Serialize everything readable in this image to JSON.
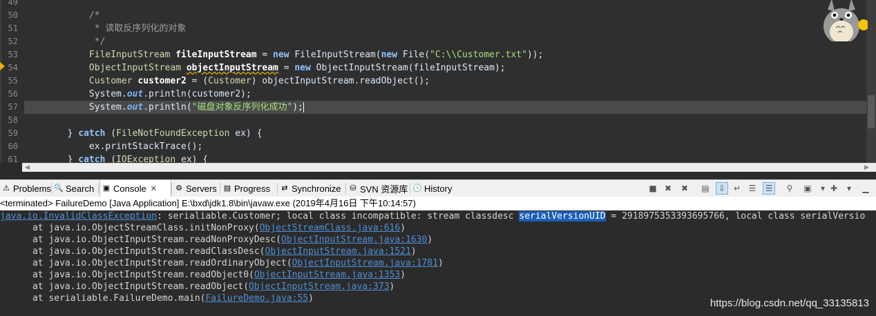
{
  "editor": {
    "line_numbers": [
      "49",
      "50",
      "51",
      "52",
      "53",
      "54",
      "55",
      "56",
      "57",
      "58",
      "59",
      "60",
      "61"
    ],
    "current_line": "57",
    "lines": [
      [
        {
          "t": "",
          "c": "pl"
        }
      ],
      [
        {
          "t": "            /*",
          "c": "cm"
        }
      ],
      [
        {
          "t": "             * 读取反序列化的对象",
          "c": "cm"
        }
      ],
      [
        {
          "t": "             */",
          "c": "cm"
        }
      ],
      [
        {
          "t": "            ",
          "c": "pl"
        },
        {
          "t": "FileInputStream",
          "c": "ty"
        },
        {
          "t": " ",
          "c": "pl"
        },
        {
          "t": "fileInputStream",
          "c": "var"
        },
        {
          "t": " = ",
          "c": "pl"
        },
        {
          "t": "new",
          "c": "kw"
        },
        {
          "t": " FileInputStream(",
          "c": "pl"
        },
        {
          "t": "new",
          "c": "kw"
        },
        {
          "t": " File(",
          "c": "pl"
        },
        {
          "t": "\"C:\\\\Customer.txt\"",
          "c": "st"
        },
        {
          "t": "));",
          "c": "pl"
        }
      ],
      [
        {
          "t": "            ",
          "c": "pl"
        },
        {
          "t": "ObjectInputStream",
          "c": "ty"
        },
        {
          "t": " ",
          "c": "pl"
        },
        {
          "t": "objectInputStream",
          "c": "var uline"
        },
        {
          "t": " = ",
          "c": "pl"
        },
        {
          "t": "new",
          "c": "kw"
        },
        {
          "t": " ObjectInputStream(fileInputStream);",
          "c": "pl"
        }
      ],
      [
        {
          "t": "            ",
          "c": "pl"
        },
        {
          "t": "Customer",
          "c": "ty"
        },
        {
          "t": " ",
          "c": "pl"
        },
        {
          "t": "customer2",
          "c": "var"
        },
        {
          "t": " = (",
          "c": "pl"
        },
        {
          "t": "Customer",
          "c": "ty"
        },
        {
          "t": ") objectInputStream.readObject();",
          "c": "pl"
        }
      ],
      [
        {
          "t": "            System.",
          "c": "pl"
        },
        {
          "t": "out",
          "c": "it"
        },
        {
          "t": ".println(customer2);",
          "c": "pl"
        }
      ],
      [
        {
          "t": "            System.",
          "c": "pl"
        },
        {
          "t": "out",
          "c": "it"
        },
        {
          "t": ".println(",
          "c": "pl"
        },
        {
          "t": "\"磁盘对象反序列化成功\"",
          "c": "st"
        },
        {
          "t": ");",
          "c": "pl"
        },
        {
          "t": "",
          "c": "caret"
        }
      ],
      [
        {
          "t": "",
          "c": "pl"
        }
      ],
      [
        {
          "t": "        } ",
          "c": "pl"
        },
        {
          "t": "catch",
          "c": "kw"
        },
        {
          "t": " (",
          "c": "pl"
        },
        {
          "t": "FileNotFoundException",
          "c": "ty"
        },
        {
          "t": " ex) {",
          "c": "pl"
        }
      ],
      [
        {
          "t": "            ex.printStackTrace();",
          "c": "pl"
        }
      ],
      [
        {
          "t": "        } ",
          "c": "pl"
        },
        {
          "t": "catch",
          "c": "kw"
        },
        {
          "t": " (",
          "c": "pl"
        },
        {
          "t": "IOException",
          "c": "ty"
        },
        {
          "t": " ex) {",
          "c": "pl"
        }
      ]
    ]
  },
  "tabs": [
    {
      "label": "Problems",
      "icon": "problems-icon",
      "glyph": "⚠"
    },
    {
      "label": "Search",
      "icon": "search-icon",
      "glyph": "🔍"
    },
    {
      "label": "Console",
      "icon": "console-icon",
      "glyph": "▣",
      "close": "✕",
      "active": true
    },
    {
      "label": "Servers",
      "icon": "servers-icon",
      "glyph": "⚙"
    },
    {
      "label": "Progress",
      "icon": "progress-icon",
      "glyph": "▤"
    },
    {
      "label": "Synchronize",
      "icon": "synchronize-icon",
      "glyph": "⇄"
    },
    {
      "label": "SVN 资源库",
      "icon": "svn-repository-icon",
      "glyph": "⛁"
    },
    {
      "label": "History",
      "icon": "history-icon",
      "glyph": "🕓"
    }
  ],
  "toolbar_icons": [
    {
      "name": "terminate-icon",
      "glyph": "■"
    },
    {
      "name": "remove-launch-icon",
      "glyph": "✖"
    },
    {
      "name": "remove-all-terminated-icon",
      "glyph": "✖"
    },
    {
      "name": "clear-console-icon",
      "glyph": "▤"
    },
    {
      "name": "scroll-lock-icon",
      "glyph": "⇩",
      "pressed": true
    },
    {
      "name": "word-wrap-icon",
      "glyph": "↵"
    },
    {
      "name": "show-on-output-icon",
      "glyph": "☰"
    },
    {
      "name": "show-on-error-icon",
      "glyph": "☰",
      "pressed": true
    },
    {
      "name": "pin-console-icon",
      "glyph": "⚲"
    },
    {
      "name": "display-selected-console-icon",
      "glyph": "▣"
    },
    {
      "name": "display-dropdown-icon",
      "glyph": "▾"
    },
    {
      "name": "open-console-icon",
      "glyph": "✚"
    },
    {
      "name": "open-console-dropdown-icon",
      "glyph": "▾"
    },
    {
      "name": "minimize-icon",
      "glyph": "▁"
    }
  ],
  "console": {
    "header": "<terminated> FailureDemo [Java Application] E:\\bxd\\jdk1.8\\bin\\javaw.exe (2019年4月16日 下午10:14:57)",
    "exception_link": "java.io.InvalidClassException",
    "exception_text_1": ": serialiable.Customer; local class incompatible: stream classdesc ",
    "exception_highlight": "serialVersionUID",
    "exception_text_2": " = 2918975353393695766, local class serialVersio",
    "trace": [
      {
        "prefix": "\tat java.io.ObjectStreamClass.initNonProxy(",
        "link": "ObjectStreamClass.java:616",
        "suffix": ")"
      },
      {
        "prefix": "\tat java.io.ObjectInputStream.readNonProxyDesc(",
        "link": "ObjectInputStream.java:1630",
        "suffix": ")"
      },
      {
        "prefix": "\tat java.io.ObjectInputStream.readClassDesc(",
        "link": "ObjectInputStream.java:1521",
        "suffix": ")"
      },
      {
        "prefix": "\tat java.io.ObjectInputStream.readOrdinaryObject(",
        "link": "ObjectInputStream.java:1781",
        "suffix": ")"
      },
      {
        "prefix": "\tat java.io.ObjectInputStream.readObject0(",
        "link": "ObjectInputStream.java:1353",
        "suffix": ")"
      },
      {
        "prefix": "\tat java.io.ObjectInputStream.readObject(",
        "link": "ObjectInputStream.java:373",
        "suffix": ")"
      },
      {
        "prefix": "\tat serialiable.FailureDemo.main(",
        "link": "FailureDemo.java:55",
        "suffix": ")"
      }
    ]
  },
  "watermark": "https://blog.csdn.net/qq_33135813"
}
